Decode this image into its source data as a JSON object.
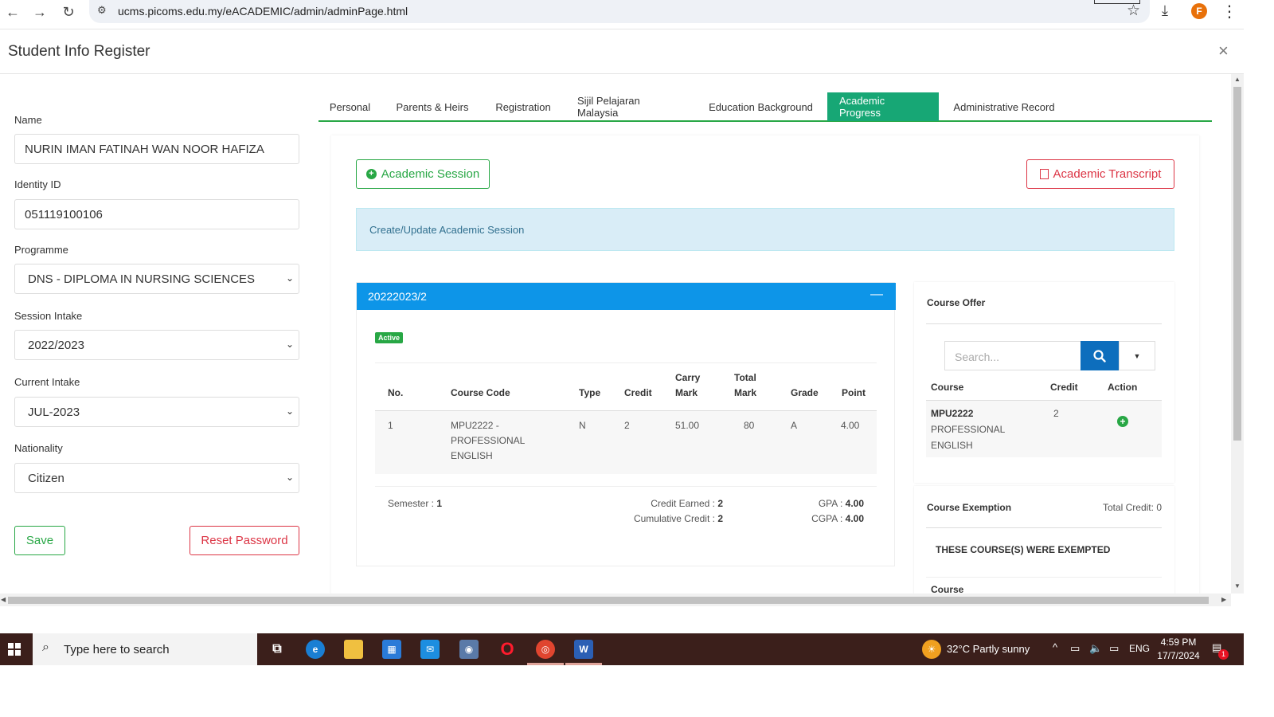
{
  "browser": {
    "url": "ucms.picoms.edu.my/eACADEMIC/admin/adminPage.html",
    "profile_initial": "F"
  },
  "modal": {
    "title": "Student Info Register",
    "close_glyph": "×"
  },
  "form": {
    "name_label": "Name",
    "name_value": "NURIN IMAN FATINAH WAN NOOR HAFIZA",
    "identity_label": "Identity ID",
    "identity_value": "051119100106",
    "programme_label": "Programme",
    "programme_value": "DNS - DIPLOMA IN NURSING SCIENCES",
    "session_label": "Session Intake",
    "session_value": "2022/2023",
    "current_label": "Current Intake",
    "current_value": "JUL-2023",
    "nationality_label": "Nationality",
    "nationality_value": "Citizen",
    "save_label": "Save",
    "reset_label": "Reset Password"
  },
  "tabs": [
    {
      "label": "Personal"
    },
    {
      "label": "Parents & Heirs"
    },
    {
      "label": "Registration"
    },
    {
      "label": "Sijil Pelajaran Malaysia"
    },
    {
      "label": "Education Background"
    },
    {
      "label": "Academic Progress",
      "active": true
    },
    {
      "label": "Administrative Record"
    }
  ],
  "academic": {
    "session_button": "Academic Session",
    "transcript_button": "Academic Transcript",
    "alert": "Create/Update Academic Session",
    "session_name": "20222023/2",
    "status_badge": "Active",
    "headers": {
      "no": "No.",
      "code": "Course Code",
      "type": "Type",
      "credit": "Credit",
      "carry1": "Carry",
      "carry2": "Mark",
      "total1": "Total",
      "total2": "Mark",
      "grade": "Grade",
      "point": "Point"
    },
    "row": {
      "no": "1",
      "code1": "MPU2222 -",
      "code2": "PROFESSIONAL",
      "code3": "ENGLISH",
      "type": "N",
      "credit": "2",
      "carry": "51.00",
      "total": "80",
      "grade": "A",
      "point": "4.00"
    },
    "footer": {
      "semester_label": "Semester : ",
      "semester_value": "1",
      "credit_earned_label": "Credit Earned : ",
      "credit_earned_value": "2",
      "cumulative_label": "Cumulative Credit : ",
      "cumulative_value": "2",
      "gpa_label": "GPA : ",
      "gpa_value": "4.00",
      "cgpa_label": "CGPA : ",
      "cgpa_value": "4.00"
    }
  },
  "offer": {
    "title": "Course Offer",
    "search_placeholder": "Search...",
    "col_course": "Course",
    "col_credit": "Credit",
    "col_action": "Action",
    "row_code": "MPU2222",
    "row_name1": "PROFESSIONAL",
    "row_name2": "ENGLISH",
    "row_credit": "2"
  },
  "exemption": {
    "title": "Course Exemption",
    "total": "Total Credit: 0",
    "note": "THESE COURSE(S) WERE EXEMPTED",
    "col_course": "Course"
  },
  "taskbar": {
    "search_text": "Type here to search",
    "weather": "32°C  Partly sunny",
    "lang": "ENG",
    "time": "4:59 PM",
    "date": "17/7/2024",
    "notification_count": "1"
  },
  "colors": {
    "success": "#28a745",
    "danger": "#dc3545",
    "primary": "#0d95e8",
    "active_tab": "#17a775",
    "taskbar": "#3b1f1b"
  }
}
